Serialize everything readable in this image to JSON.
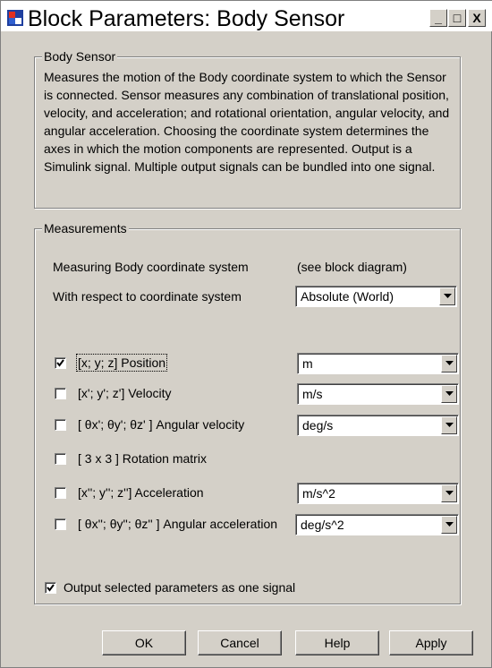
{
  "window": {
    "title": "Block Parameters: Body Sensor",
    "minimize_glyph": "_",
    "maximize_glyph": "□",
    "close_glyph": "X"
  },
  "description_group": {
    "legend": "Body Sensor",
    "text": "Measures the motion of the Body coordinate system to which the Sensor is connected. Sensor measures any combination of translational position, velocity, and acceleration; and rotational orientation, angular velocity, and angular acceleration. Choosing the coordinate system determines the axes in which the motion components are represented. Output is a Simulink signal. Multiple output signals can be bundled into one signal."
  },
  "measurements": {
    "legend": "Measurements",
    "measuring_label": "Measuring Body coordinate system",
    "measuring_value": "(see block diagram)",
    "respect_label": "With respect to coordinate system",
    "respect_value": "Absolute (World)",
    "rows": [
      {
        "label": "[x; y; z] Position",
        "checked": true,
        "unit": "m"
      },
      {
        "label": "[x'; y'; z'] Velocity",
        "checked": false,
        "unit": "m/s"
      },
      {
        "label": "[ θx'; θy'; θz' ] Angular velocity",
        "checked": false,
        "unit": "deg/s"
      },
      {
        "label": "[ 3 x 3 ] Rotation matrix",
        "checked": false,
        "unit": null
      },
      {
        "label": "[x''; y''; z''] Acceleration",
        "checked": false,
        "unit": "m/s^2"
      },
      {
        "label": "[ θx''; θy''; θz'' ] Angular acceleration",
        "checked": false,
        "unit": "deg/s^2"
      }
    ],
    "output_label": "Output selected parameters as one signal",
    "output_checked": true
  },
  "buttons": {
    "ok": "OK",
    "cancel": "Cancel",
    "help": "Help",
    "apply": "Apply"
  },
  "icons": {
    "app": "simulink-block-icon",
    "dropdown": "chevron-down-icon",
    "check": "check-icon"
  }
}
